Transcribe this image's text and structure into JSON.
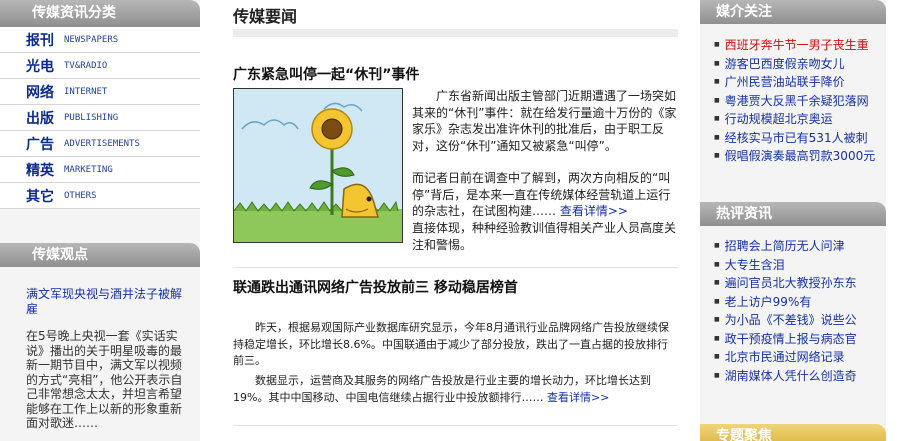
{
  "left": {
    "categories_title": "传媒资讯分类",
    "categories": [
      {
        "cn": "报刊",
        "en": "NEWSPAPERS"
      },
      {
        "cn": "光电",
        "en": "TV&RADIO"
      },
      {
        "cn": "网络",
        "en": "INTERNET"
      },
      {
        "cn": "出版",
        "en": "PUBLISHING"
      },
      {
        "cn": "广告",
        "en": "ADVERTISEMENTS"
      },
      {
        "cn": "精英",
        "en": "MARKETING"
      },
      {
        "cn": "其它",
        "en": "OTHERS"
      }
    ],
    "views_title": "传媒观点",
    "views_headline": "满文军现央视与酒井法子被解雇",
    "views_text": "在5号晚上央视一套《实话实说》播出的关于明星吸毒的最新一期节目中，满文军以视频的方式“亮相”，他公开表示自己非常想念太太，并坦言希望能够在工作上以新的形象重新面对歌迷……"
  },
  "main": {
    "section_title": "传媒要闻",
    "article1": {
      "title": "广东紧急叫停一起“休刊”事件",
      "p1": "广东省新闻出版主管部门近期遭遇了一场突如其来的“休刊”事件：就在给发行量逾十万份的《家家乐》杂志发出准许休刊的批准后，由于职工反对，这份“休刊”通知又被紧急“叫停”。",
      "p2": "而记者日前在调查中了解到，两次方向相反的“叫停”背后，是本来一直在传统媒体经营轨道上运行的杂志社，在试图构建……",
      "more": "查看详情>>",
      "p3": "直接体现，种种经验教训值得相关产业人员高度关注和警惕。"
    },
    "article2": {
      "title": "联通跌出通讯网络广告投放前三  移动稳居榜首",
      "p1": "昨天，根据易观国际产业数据库研究显示，今年8月通讯行业品牌网络广告投放继续保持稳定增长，环比增长8.6%。中国联通由于减少了部分投放，跌出了一直占据的投放排行前三。",
      "p2": "数据显示，运营商及其服务的网络广告投放是行业主要的增长动力，环比增长达到19%。其中中国移动、中国电信继续占据行业中投放额排行……",
      "more": "查看详情>>"
    }
  },
  "right": {
    "media_title": "媒介关注",
    "media_items": [
      "西班牙奔牛节一男子丧生重",
      "游客巴西度假亲吻女儿",
      "广州民营油站联手降价",
      "粤港贾大反黑千余疑犯落网",
      "行动规模超北京奥运",
      "经核实马市已有531人被刺",
      "假唱假演奏最高罚款3000元"
    ],
    "hot_title": "热评资讯",
    "hot_items": [
      "招聘会上简历无人问津",
      "大专生含泪",
      "遍问官员北大教授孙东东",
      "老上访户99%有",
      "为小品《不差钱》说些公",
      "政干预疫情上报与病态官",
      "北京市民通过网络记录",
      "湖南媒体人凭什么创造奇"
    ],
    "bottom_title": "专题聚焦"
  }
}
